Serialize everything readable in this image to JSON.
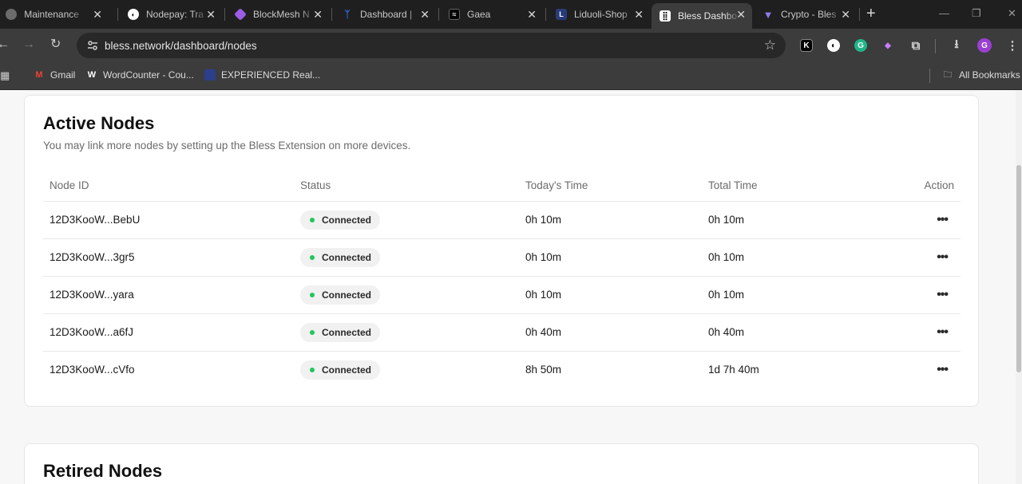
{
  "browser": {
    "tabs": [
      {
        "title": "Maintenance",
        "icon": "globe-icon",
        "color": "#7a7a7a"
      },
      {
        "title": "Nodepay: Tra",
        "icon": "nodepay-icon",
        "color": "#ffffff"
      },
      {
        "title": "BlockMesh N",
        "icon": "blockmesh-icon",
        "color": "#9b5de5"
      },
      {
        "title": "Dashboard |",
        "icon": "dashboard-icon",
        "color": "#2d6cdf"
      },
      {
        "title": "Gaea",
        "icon": "gaea-icon",
        "color": "#111111"
      },
      {
        "title": "Liduoli-Shop",
        "icon": "liduoli-icon",
        "color": "#2a3b7a"
      },
      {
        "title": "Bless Dashbo",
        "icon": "bless-icon",
        "color": "#ffffff",
        "active": true
      },
      {
        "title": "Crypto - Bles",
        "icon": "crypto-icon",
        "color": "#6a5acd"
      }
    ],
    "new_tab": "+",
    "url": "bless.network/dashboard/nodes",
    "bookmarks": [
      {
        "label": "Gmail",
        "icon": "gmail-icon"
      },
      {
        "label": "WordCounter - Cou...",
        "icon": "wordcounter-icon"
      },
      {
        "label": "EXPERIENCED Real...",
        "icon": "experienced-icon"
      }
    ],
    "all_bookmarks": "All Bookmarks",
    "profile_initial": "G"
  },
  "active_nodes": {
    "title": "Active Nodes",
    "subtitle": "You may link more nodes by setting up the Bless Extension on more devices.",
    "columns": [
      "Node ID",
      "Status",
      "Today's Time",
      "Total Time",
      "Action"
    ],
    "rows": [
      {
        "node_id": "12D3KooW...BebU",
        "status": "Connected",
        "today": "0h 10m",
        "total": "0h 10m"
      },
      {
        "node_id": "12D3KooW...3gr5",
        "status": "Connected",
        "today": "0h 10m",
        "total": "0h 10m"
      },
      {
        "node_id": "12D3KooW...yara",
        "status": "Connected",
        "today": "0h 10m",
        "total": "0h 10m"
      },
      {
        "node_id": "12D3KooW...a6fJ",
        "status": "Connected",
        "today": "0h 40m",
        "total": "0h 40m"
      },
      {
        "node_id": "12D3KooW...cVfo",
        "status": "Connected",
        "today": "8h 50m",
        "total": "1d 7h 40m"
      }
    ]
  },
  "retired_nodes": {
    "title": "Retired Nodes"
  }
}
